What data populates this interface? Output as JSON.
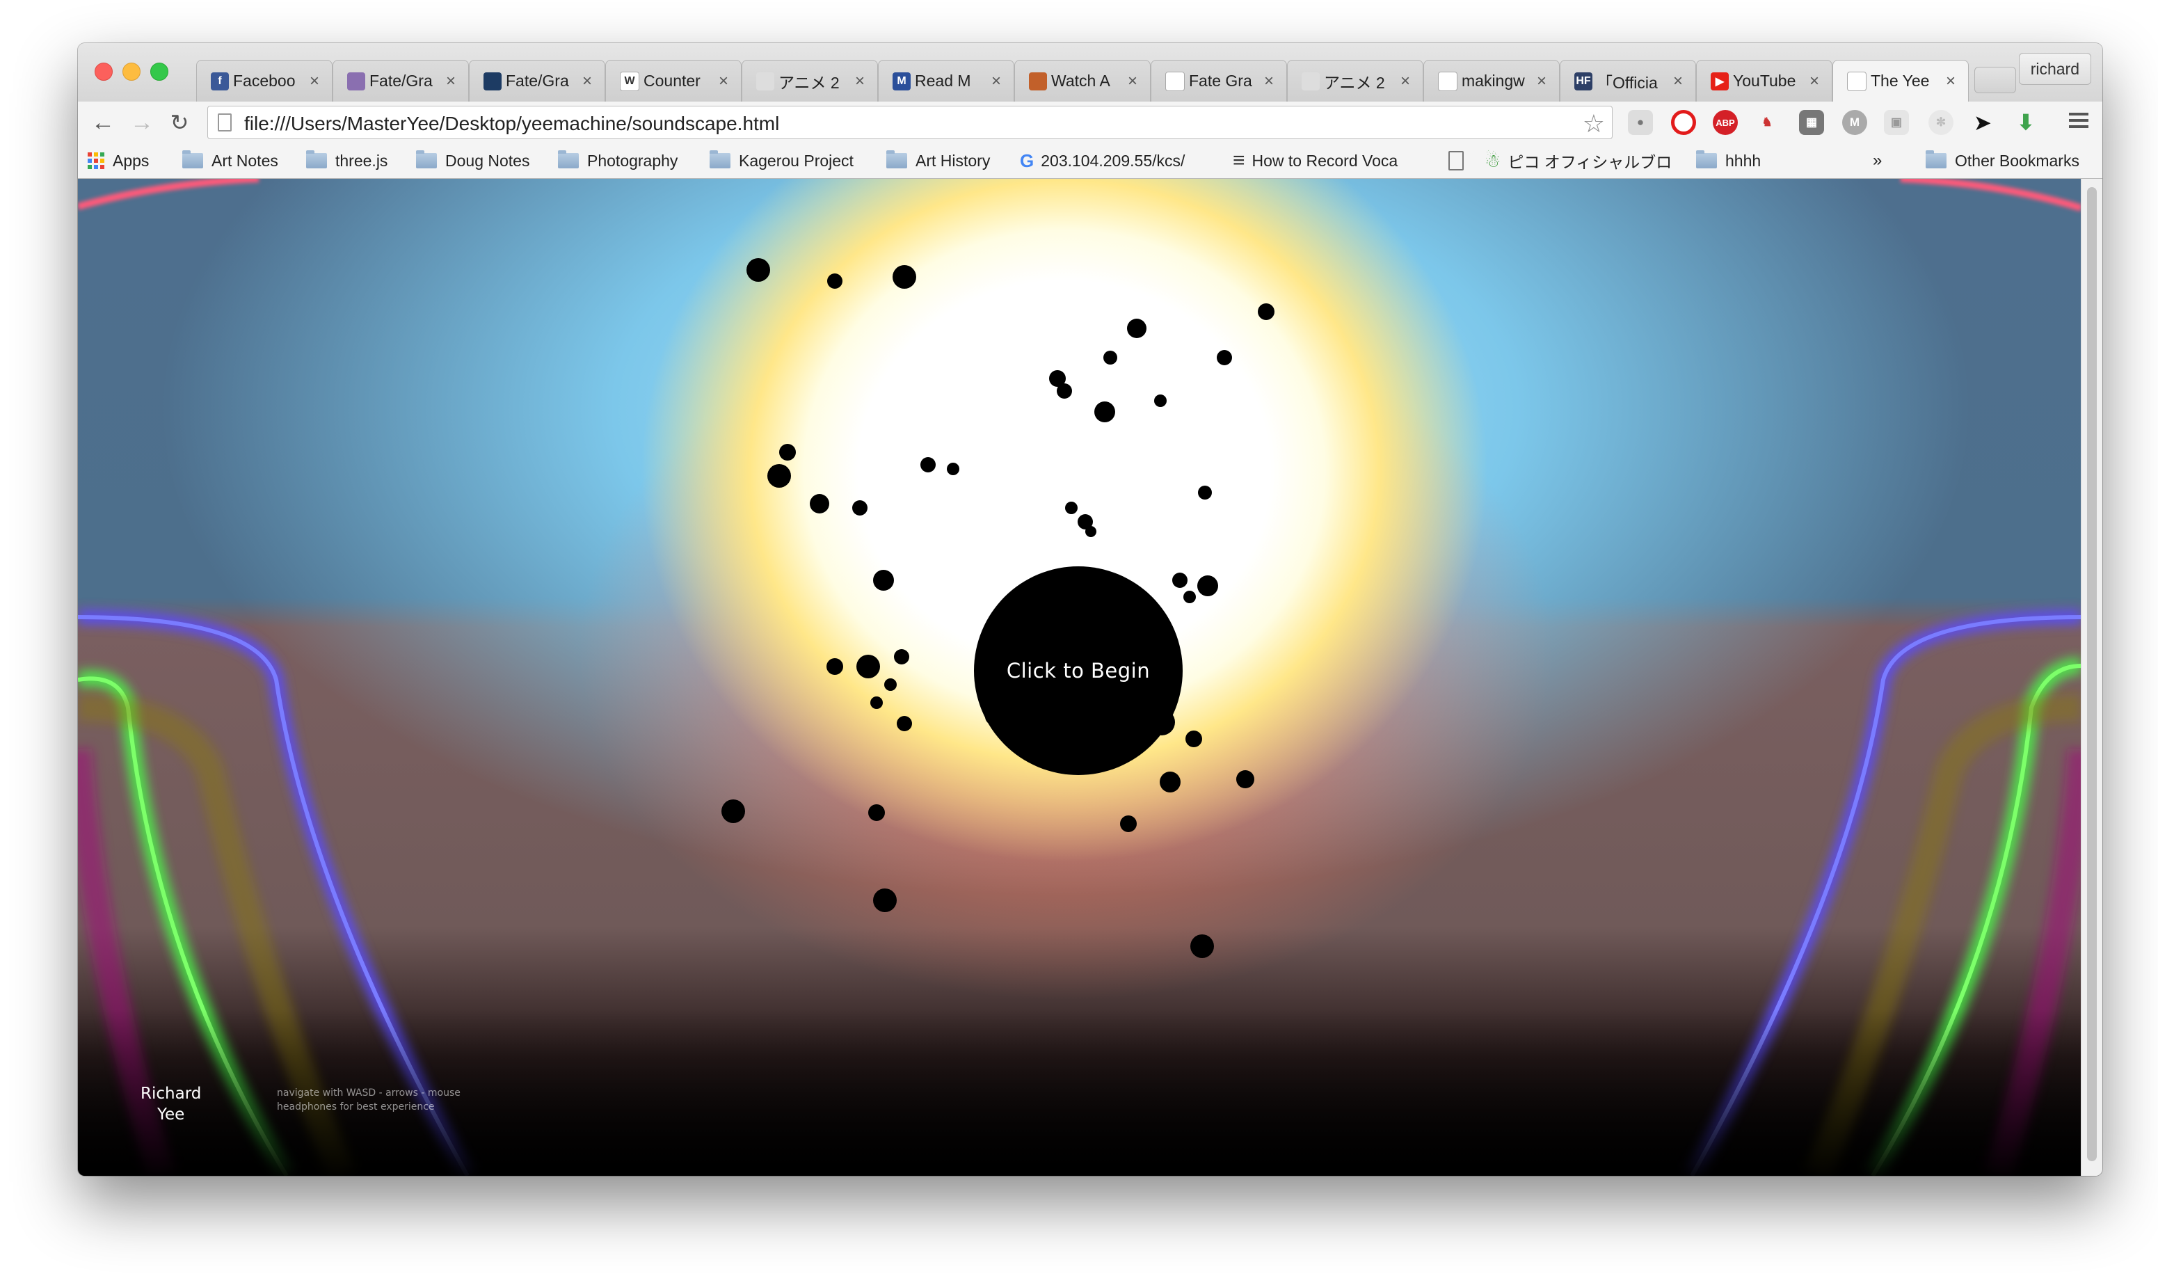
{
  "browser": {
    "tabs": [
      {
        "title": "Faceboo",
        "icon": "facebook-icon",
        "color": "#3b5998",
        "glyph": "f"
      },
      {
        "title": "Fate/Gra",
        "icon": "fate-icon",
        "color": "#8a6fb0",
        "glyph": ""
      },
      {
        "title": "Fate/Gra",
        "icon": "fate-wiki-icon",
        "color": "#1d3b63",
        "glyph": ""
      },
      {
        "title": "Counter",
        "icon": "wikipedia-icon",
        "color": "#ffffff",
        "glyph": "W"
      },
      {
        "title": "アニメ 2",
        "icon": "tv-icon",
        "color": "#dddddd",
        "glyph": ""
      },
      {
        "title": "Read M",
        "icon": "manga-icon",
        "color": "#2b4f9a",
        "glyph": "M"
      },
      {
        "title": "Watch A",
        "icon": "anime-icon",
        "color": "#c2602a",
        "glyph": ""
      },
      {
        "title": "Fate Gra",
        "icon": "reddit-icon",
        "color": "#ffffff",
        "glyph": ""
      },
      {
        "title": "アニメ 2",
        "icon": "tv-icon",
        "color": "#dddddd",
        "glyph": ""
      },
      {
        "title": "makingw",
        "icon": "circle-logo-icon",
        "color": "#ffffff",
        "glyph": ""
      },
      {
        "title": "「Officia",
        "icon": "hf-icon",
        "color": "#2d3f66",
        "glyph": "HF"
      },
      {
        "title": "YouTube",
        "icon": "youtube-icon",
        "color": "#e62117",
        "glyph": "▶"
      },
      {
        "title": "The Yee",
        "icon": "page-icon",
        "color": "#ffffff",
        "glyph": ""
      }
    ],
    "profile": "richard",
    "url": "file:///Users/MasterYee/Desktop/yeemachine/soundscape.html",
    "bookmarks": [
      {
        "label": "Apps",
        "type": "apps"
      },
      {
        "label": "Art Notes",
        "type": "folder"
      },
      {
        "label": "three.js",
        "type": "folder"
      },
      {
        "label": "Doug Notes",
        "type": "folder"
      },
      {
        "label": "Photography",
        "type": "folder"
      },
      {
        "label": "Kagerou Project",
        "type": "folder"
      },
      {
        "label": "Art History",
        "type": "folder"
      },
      {
        "label": "203.104.209.55/kcs/",
        "type": "google"
      },
      {
        "label": "How to Record Voca",
        "type": "filter"
      },
      {
        "label": "",
        "type": "page"
      },
      {
        "label": "ピコ オフィシャルブロ",
        "type": "android"
      },
      {
        "label": "hhhh",
        "type": "folder"
      },
      {
        "label": "»",
        "type": "more"
      },
      {
        "label": "Other Bookmarks",
        "type": "folder"
      }
    ]
  },
  "page": {
    "begin_label": "Click to Begin",
    "author_line1": "Richard",
    "author_line2": "Yee",
    "hint_line1": "navigate with WASD - arrows - mouse",
    "hint_line2": "headphones for best experience"
  }
}
